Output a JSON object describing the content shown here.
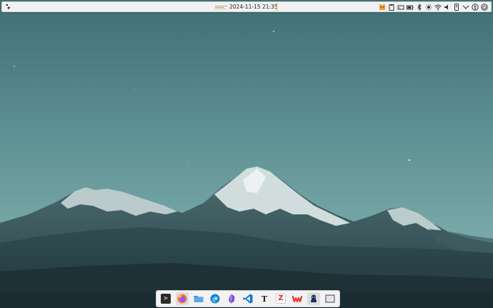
{
  "topbar": {
    "clock": "2024-11-15 21:35",
    "launcher_icon": "activities-icon",
    "tray_icons": [
      "cat-icon",
      "clipboard-icon",
      "drive-icon",
      "battery-icon",
      "bluetooth-icon",
      "brightness-icon",
      "wifi-icon",
      "volume-icon",
      "phone-icon",
      "chevron-down-icon",
      "a11y-icon",
      "power-icon"
    ]
  },
  "dock": {
    "apps": [
      {
        "name": "terminal",
        "icon": "terminal-icon",
        "label": ">"
      },
      {
        "name": "firefox",
        "icon": "firefox-icon",
        "active": true
      },
      {
        "name": "files",
        "icon": "folder-icon"
      },
      {
        "name": "edge",
        "icon": "edge-icon"
      },
      {
        "name": "obsidian",
        "icon": "obsidian-icon"
      },
      {
        "name": "vscode",
        "icon": "vscode-icon"
      },
      {
        "name": "typora",
        "icon": "typora-icon",
        "label": "T"
      },
      {
        "name": "zotero",
        "icon": "zotero-icon",
        "label": "Z"
      },
      {
        "name": "wps",
        "icon": "wps-icon"
      },
      {
        "name": "qq",
        "icon": "qq-icon"
      },
      {
        "name": "show-desktop",
        "icon": "window-icon"
      }
    ]
  },
  "colors": {
    "accent": "#e39b46",
    "sky_top": "#3c6d72",
    "sky_bottom": "#89b8b7"
  }
}
